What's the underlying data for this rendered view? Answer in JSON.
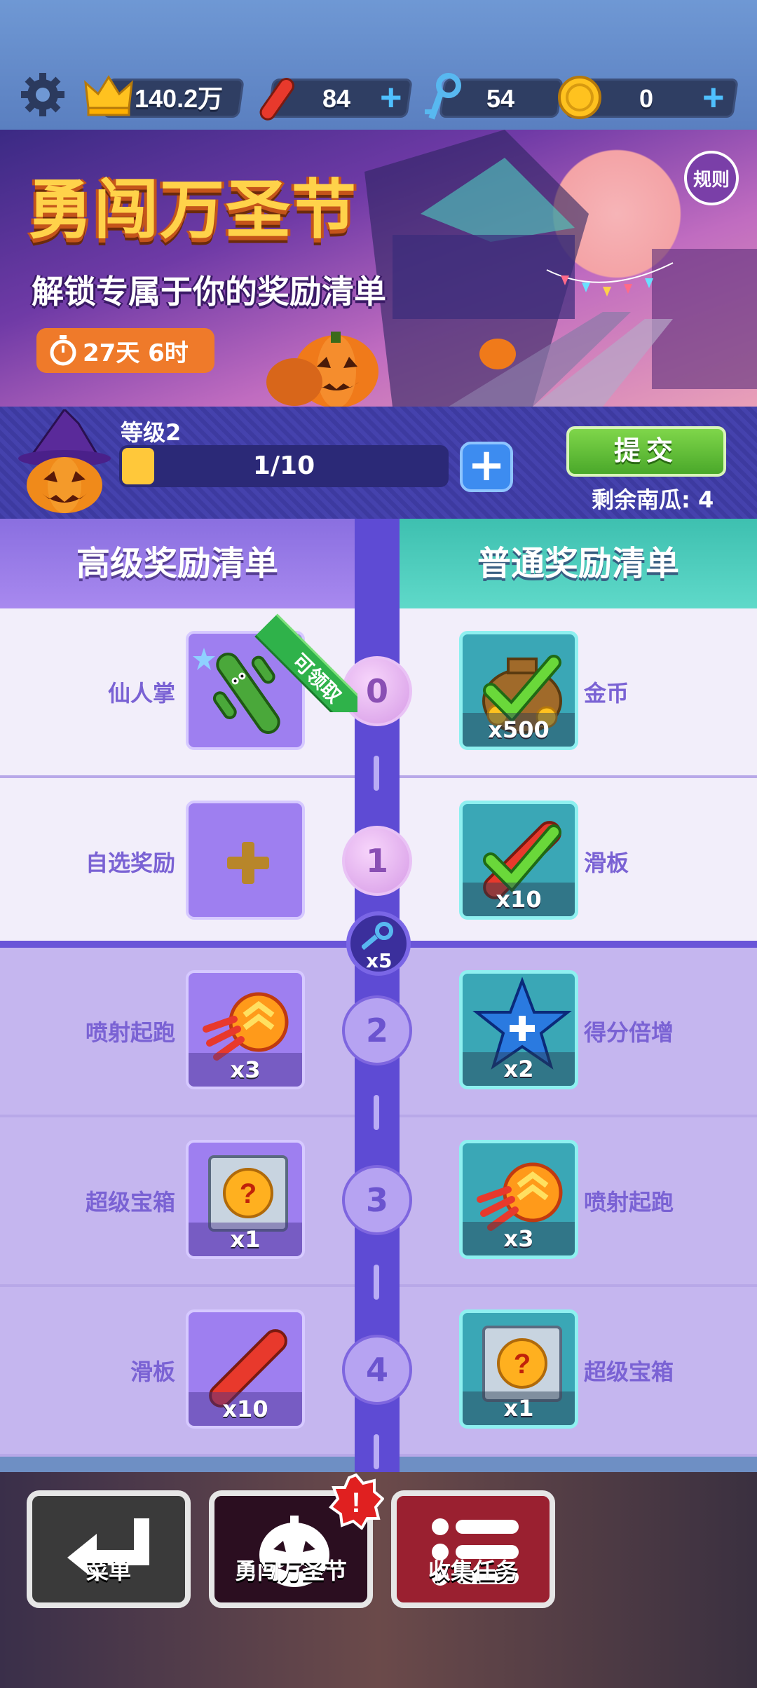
{
  "topbar": {
    "crown_value": "140.2万",
    "boards_value": "84",
    "keys_value": "54",
    "coins_value": "0",
    "plus_glyph": "+"
  },
  "banner": {
    "title": "勇闯万圣节",
    "subtitle": "解锁专属于你的奖励清单",
    "timer": "27天 6时",
    "rules_label": "规则"
  },
  "level": {
    "label": "等级2",
    "progress_text": "1/10",
    "progress_fraction": 0.1,
    "plus_glyph": "+",
    "submit_label": "提交",
    "remaining_label": "剩余南瓜: 4"
  },
  "columns": {
    "premium_title": "高级奖励清单",
    "normal_title": "普通奖励清单"
  },
  "rows": [
    {
      "level": "0",
      "premium_label": "仙人掌",
      "premium_qty": "",
      "normal_label": "金币",
      "normal_qty": "x500",
      "ribbon": "可领取"
    },
    {
      "level": "1",
      "premium_label": "自选奖励",
      "premium_qty": "",
      "normal_label": "滑板",
      "normal_qty": "x10"
    },
    {
      "level": "2",
      "premium_label": "喷射起跑",
      "premium_qty": "x3",
      "normal_label": "得分倍增",
      "normal_qty": "x2"
    },
    {
      "level": "3",
      "premium_label": "超级宝箱",
      "premium_qty": "x1",
      "normal_label": "喷射起跑",
      "normal_qty": "x3"
    },
    {
      "level": "4",
      "premium_label": "滑板",
      "premium_qty": "x10",
      "normal_label": "超级宝箱",
      "normal_qty": "x1"
    }
  ],
  "key_milestone": "x5",
  "nav": {
    "menu_label": "菜单",
    "event_label": "勇闯万圣节",
    "tasks_label": "收集任务",
    "alert_glyph": "!"
  }
}
